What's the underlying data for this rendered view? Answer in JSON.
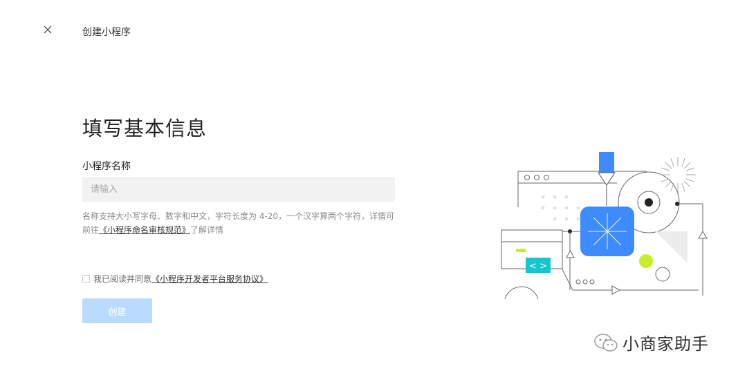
{
  "header": {
    "close_icon": "close-icon",
    "title": "创建小程序"
  },
  "form": {
    "heading": "填写基本信息",
    "name_label": "小程序名称",
    "name_placeholder": "请输入",
    "name_value": "",
    "hint_text_1": "名称支持大小写字母、数字和中文，字符长度为 4-20，一个汉字算两个字符，详情可前往",
    "hint_link": "《小程序命名审核规范》",
    "hint_text_2": "了解详情",
    "agree_checked": false,
    "agree_text": "我已阅读并同意",
    "agree_link": "《小程序开发者平台服务协议》",
    "create_button": "创建",
    "create_enabled": false
  },
  "illustration": {
    "name": "mini-program-illustration",
    "accent_blue": "#3d8bfd",
    "accent_lime": "#c8ee2a",
    "accent_cyan": "#14c6cf",
    "code_glyph": "< >"
  },
  "watermark": {
    "icon": "wechat-icon",
    "text": "小商家助手"
  },
  "colors": {
    "button_disabled_bg": "#b9dbff",
    "input_bg": "#f2f2f2",
    "hint_color": "#8a8a8a"
  }
}
